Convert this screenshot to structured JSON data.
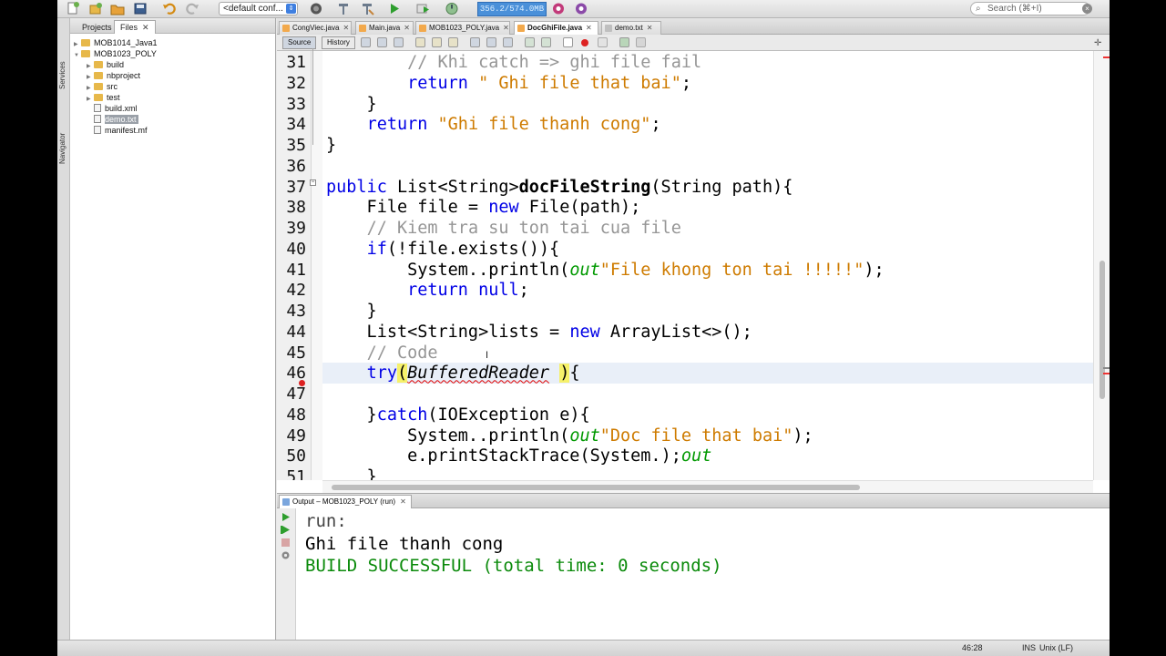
{
  "toolbar": {
    "config": "<default conf...",
    "memory": "356.2/574.0MB",
    "search_placeholder": "Search (⌘+I)",
    "icons": [
      "new-file-icon",
      "new-project-icon",
      "open-project-icon",
      "save-all-icon",
      "undo-icon",
      "redo-icon",
      "build-icon",
      "clean-build-icon",
      "run-icon",
      "debug-icon",
      "profile-icon",
      "gc-icon",
      "profiler-icon"
    ]
  },
  "side_strip": {
    "services": "Services",
    "navigator": "Navigator"
  },
  "left_panel": {
    "tabs": [
      {
        "label": "Projects"
      },
      {
        "label": "Files"
      }
    ],
    "tree": [
      {
        "label": "MOB1014_Java1",
        "type": "folder"
      },
      {
        "label": "MOB1023_POLY",
        "type": "folder"
      },
      {
        "label": "build",
        "type": "folder"
      },
      {
        "label": "nbproject",
        "type": "folder"
      },
      {
        "label": "src",
        "type": "folder"
      },
      {
        "label": "test",
        "type": "folder"
      },
      {
        "label": "build.xml",
        "type": "file"
      },
      {
        "label": "demo.txt",
        "type": "file"
      },
      {
        "label": "manifest.mf",
        "type": "file"
      }
    ]
  },
  "editor": {
    "tabs": [
      {
        "label": "CongViec.java"
      },
      {
        "label": "Main.java"
      },
      {
        "label": "MOB1023_POLY.java"
      },
      {
        "label": "DocGhiFile.java"
      },
      {
        "label": "demo.txt"
      }
    ],
    "source_label": "Source",
    "history_label": "History",
    "line_numbers": [
      "31",
      "32",
      "33",
      "34",
      "35",
      "36",
      "37",
      "38",
      "39",
      "40",
      "41",
      "42",
      "43",
      "44",
      "45",
      "46",
      "47",
      "48",
      "49",
      "50",
      "51"
    ],
    "lines": [
      {
        "t1": "        ",
        "c1": "// Khi catch => ghi file fail"
      },
      {
        "t1": "        ",
        "k1": "return",
        "t2": " ",
        "s1": "\" Ghi file that bai\"",
        "t3": ";"
      },
      {
        "t1": "    }"
      },
      {
        "t1": "    ",
        "k1": "return",
        "t2": " ",
        "s1": "\"Ghi file thanh cong\"",
        "t3": ";"
      },
      {
        "t1": "}"
      },
      {
        "t1": ""
      },
      {
        "k1": "public",
        "t1": " List<String>",
        "b1": "docFileString",
        "t2": "(String path){"
      },
      {
        "t1": "    File file = ",
        "k1": "new",
        "t2": " File(path);"
      },
      {
        "t1": "    ",
        "c1": "// Kiem tra su ton tai cua file"
      },
      {
        "t1": "    ",
        "k1": "if",
        "t2": "(!file.exists()){"
      },
      {
        "t1": "        System.",
        "f1": "out",
        "t2": ".println(",
        "s1": "\"File khong ton tai !!!!!\"",
        "t3": ");"
      },
      {
        "t1": "        ",
        "k1": "return",
        "t2": " ",
        "k2": "null",
        "t3": ";"
      },
      {
        "t1": "    }"
      },
      {
        "t1": "    List<String>lists = ",
        "k1": "new",
        "t2": " ArrayList<>();"
      },
      {
        "t1": "    ",
        "c1": "// Code"
      },
      {
        "t1": "    ",
        "k1": "try",
        "h1": "(",
        "i1": "BufferedReader",
        "t2": " ",
        "h2": ")",
        "t3": "{"
      },
      {
        "t1": ""
      },
      {
        "t1": "    }",
        "k1": "catch",
        "t2": "(IOException e){"
      },
      {
        "t1": "        System.",
        "f1": "out",
        "t2": ".println(",
        "s1": "\"Doc file that bai\"",
        "t3": ");"
      },
      {
        "t1": "        e.printStackTrace(System.",
        "f1": "out",
        "t2": ");"
      },
      {
        "t1": "    }"
      }
    ]
  },
  "output": {
    "tab_label": "Output – MOB1023_POLY (run)",
    "line1": "run:",
    "line2": "Ghi file thanh cong",
    "line3": "BUILD SUCCESSFUL (total time: 0 seconds)"
  },
  "status": {
    "position": "46:28",
    "mode": "INS",
    "eol": "Unix (LF)"
  },
  "colors": {
    "keyword": "#0000e6",
    "string": "#ce7b00",
    "comment": "#969696",
    "field": "#009900",
    "success": "#0a8a0a"
  }
}
